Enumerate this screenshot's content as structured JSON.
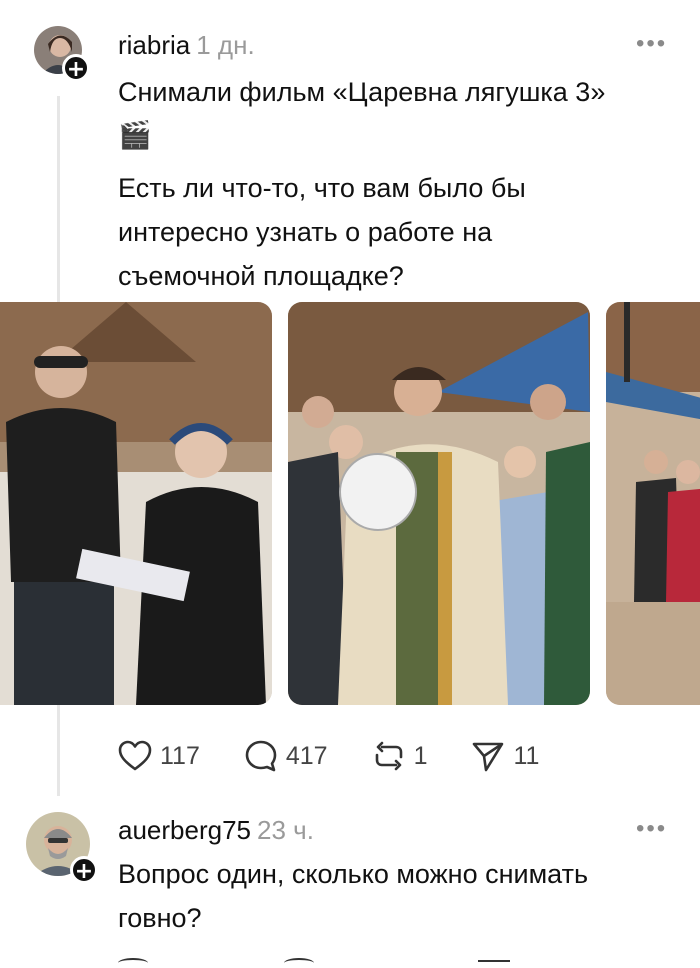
{
  "post": {
    "username": "riabria",
    "time": "1 дн.",
    "more_label": "•••",
    "line1": "Снимали фильм «Царевна лягушка 3»",
    "emoji": "🎬",
    "question_line1": "Есть ли что-то, что вам было бы",
    "question_line2": "интересно узнать о работе на",
    "question_line3": "съемочной площадке?",
    "actions": {
      "likes": "117",
      "comments": "417",
      "reposts": "1",
      "shares": "11"
    },
    "icons": [
      "heart-icon",
      "comment-icon",
      "repost-icon",
      "share-icon"
    ]
  },
  "reply": {
    "username": "auerberg75",
    "time": "23 ч.",
    "more_label": "•••",
    "line1": "Вопрос один, сколько можно снимать",
    "line2": "говно?"
  },
  "colors": {
    "text": "#111111",
    "muted": "#9a9a9a",
    "thread_line": "#e6e6e6"
  }
}
